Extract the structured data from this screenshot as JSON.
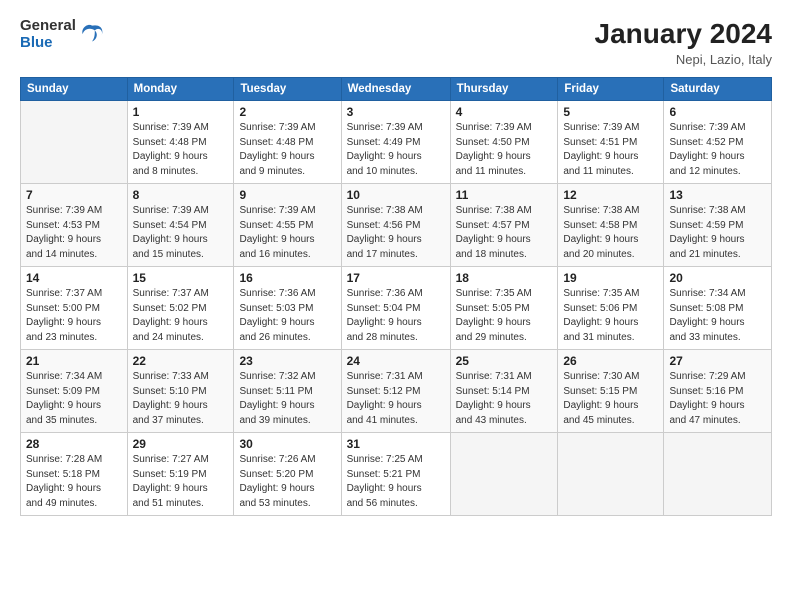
{
  "logo": {
    "general": "General",
    "blue": "Blue"
  },
  "title": "January 2024",
  "location": "Nepi, Lazio, Italy",
  "days_of_week": [
    "Sunday",
    "Monday",
    "Tuesday",
    "Wednesday",
    "Thursday",
    "Friday",
    "Saturday"
  ],
  "weeks": [
    [
      {
        "day": "",
        "info": ""
      },
      {
        "day": "1",
        "info": "Sunrise: 7:39 AM\nSunset: 4:48 PM\nDaylight: 9 hours\nand 8 minutes."
      },
      {
        "day": "2",
        "info": "Sunrise: 7:39 AM\nSunset: 4:48 PM\nDaylight: 9 hours\nand 9 minutes."
      },
      {
        "day": "3",
        "info": "Sunrise: 7:39 AM\nSunset: 4:49 PM\nDaylight: 9 hours\nand 10 minutes."
      },
      {
        "day": "4",
        "info": "Sunrise: 7:39 AM\nSunset: 4:50 PM\nDaylight: 9 hours\nand 11 minutes."
      },
      {
        "day": "5",
        "info": "Sunrise: 7:39 AM\nSunset: 4:51 PM\nDaylight: 9 hours\nand 11 minutes."
      },
      {
        "day": "6",
        "info": "Sunrise: 7:39 AM\nSunset: 4:52 PM\nDaylight: 9 hours\nand 12 minutes."
      }
    ],
    [
      {
        "day": "7",
        "info": "Sunrise: 7:39 AM\nSunset: 4:53 PM\nDaylight: 9 hours\nand 14 minutes."
      },
      {
        "day": "8",
        "info": "Sunrise: 7:39 AM\nSunset: 4:54 PM\nDaylight: 9 hours\nand 15 minutes."
      },
      {
        "day": "9",
        "info": "Sunrise: 7:39 AM\nSunset: 4:55 PM\nDaylight: 9 hours\nand 16 minutes."
      },
      {
        "day": "10",
        "info": "Sunrise: 7:38 AM\nSunset: 4:56 PM\nDaylight: 9 hours\nand 17 minutes."
      },
      {
        "day": "11",
        "info": "Sunrise: 7:38 AM\nSunset: 4:57 PM\nDaylight: 9 hours\nand 18 minutes."
      },
      {
        "day": "12",
        "info": "Sunrise: 7:38 AM\nSunset: 4:58 PM\nDaylight: 9 hours\nand 20 minutes."
      },
      {
        "day": "13",
        "info": "Sunrise: 7:38 AM\nSunset: 4:59 PM\nDaylight: 9 hours\nand 21 minutes."
      }
    ],
    [
      {
        "day": "14",
        "info": "Sunrise: 7:37 AM\nSunset: 5:00 PM\nDaylight: 9 hours\nand 23 minutes."
      },
      {
        "day": "15",
        "info": "Sunrise: 7:37 AM\nSunset: 5:02 PM\nDaylight: 9 hours\nand 24 minutes."
      },
      {
        "day": "16",
        "info": "Sunrise: 7:36 AM\nSunset: 5:03 PM\nDaylight: 9 hours\nand 26 minutes."
      },
      {
        "day": "17",
        "info": "Sunrise: 7:36 AM\nSunset: 5:04 PM\nDaylight: 9 hours\nand 28 minutes."
      },
      {
        "day": "18",
        "info": "Sunrise: 7:35 AM\nSunset: 5:05 PM\nDaylight: 9 hours\nand 29 minutes."
      },
      {
        "day": "19",
        "info": "Sunrise: 7:35 AM\nSunset: 5:06 PM\nDaylight: 9 hours\nand 31 minutes."
      },
      {
        "day": "20",
        "info": "Sunrise: 7:34 AM\nSunset: 5:08 PM\nDaylight: 9 hours\nand 33 minutes."
      }
    ],
    [
      {
        "day": "21",
        "info": "Sunrise: 7:34 AM\nSunset: 5:09 PM\nDaylight: 9 hours\nand 35 minutes."
      },
      {
        "day": "22",
        "info": "Sunrise: 7:33 AM\nSunset: 5:10 PM\nDaylight: 9 hours\nand 37 minutes."
      },
      {
        "day": "23",
        "info": "Sunrise: 7:32 AM\nSunset: 5:11 PM\nDaylight: 9 hours\nand 39 minutes."
      },
      {
        "day": "24",
        "info": "Sunrise: 7:31 AM\nSunset: 5:12 PM\nDaylight: 9 hours\nand 41 minutes."
      },
      {
        "day": "25",
        "info": "Sunrise: 7:31 AM\nSunset: 5:14 PM\nDaylight: 9 hours\nand 43 minutes."
      },
      {
        "day": "26",
        "info": "Sunrise: 7:30 AM\nSunset: 5:15 PM\nDaylight: 9 hours\nand 45 minutes."
      },
      {
        "day": "27",
        "info": "Sunrise: 7:29 AM\nSunset: 5:16 PM\nDaylight: 9 hours\nand 47 minutes."
      }
    ],
    [
      {
        "day": "28",
        "info": "Sunrise: 7:28 AM\nSunset: 5:18 PM\nDaylight: 9 hours\nand 49 minutes."
      },
      {
        "day": "29",
        "info": "Sunrise: 7:27 AM\nSunset: 5:19 PM\nDaylight: 9 hours\nand 51 minutes."
      },
      {
        "day": "30",
        "info": "Sunrise: 7:26 AM\nSunset: 5:20 PM\nDaylight: 9 hours\nand 53 minutes."
      },
      {
        "day": "31",
        "info": "Sunrise: 7:25 AM\nSunset: 5:21 PM\nDaylight: 9 hours\nand 56 minutes."
      },
      {
        "day": "",
        "info": ""
      },
      {
        "day": "",
        "info": ""
      },
      {
        "day": "",
        "info": ""
      }
    ]
  ]
}
